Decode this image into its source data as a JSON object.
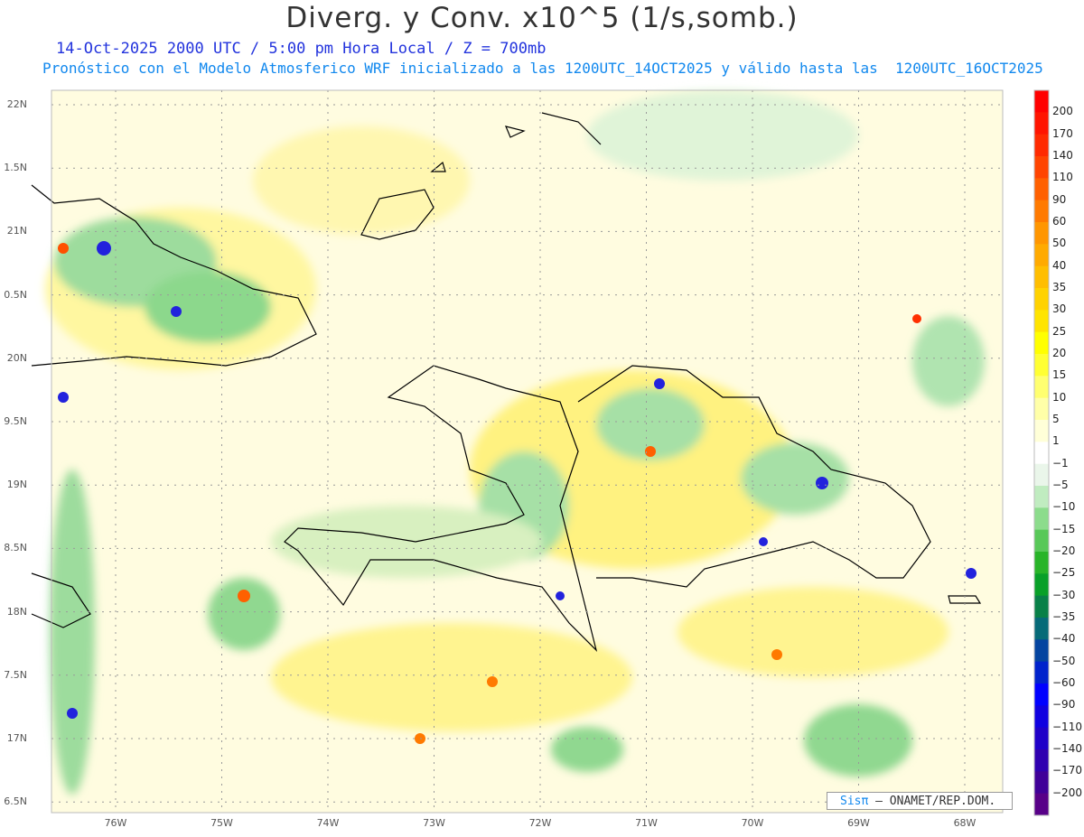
{
  "title": "Diverg. y Conv. x10^5 (1/s,somb.)",
  "subtitle1": "14-Oct-2025  2000 UTC / 5:00 pm Hora Local / Z = 700mb",
  "subtitle2": "Pronóstico con el Modelo Atmosferico WRF inicializado a las 1200UTC_14OCT2025 y válido hasta las  1200UTC_16OCT2025",
  "lat_labels": [
    "22N",
    "1.5N",
    "21N",
    "0.5N",
    "20N",
    "9.5N",
    "19N",
    "8.5N",
    "18N",
    "7.5N",
    "17N",
    "6.5N"
  ],
  "lon_labels": [
    "76W",
    "75W",
    "74W",
    "73W",
    "72W",
    "71W",
    "70W",
    "69W",
    "68W"
  ],
  "colorbar": {
    "labels": [
      "200",
      "170",
      "140",
      "110",
      "90",
      "60",
      "50",
      "40",
      "35",
      "30",
      "25",
      "20",
      "15",
      "10",
      "5",
      "1",
      "−1",
      "−5",
      "−10",
      "−15",
      "−20",
      "−25",
      "−30",
      "−35",
      "−40",
      "−50",
      "−60",
      "−90",
      "−110",
      "−140",
      "−170",
      "−200"
    ],
    "colors": [
      "#ff0000",
      "#ff1400",
      "#ff2a00",
      "#ff4400",
      "#ff6000",
      "#ff7a00",
      "#ff9600",
      "#ffaa00",
      "#ffbe00",
      "#ffd200",
      "#ffe400",
      "#ffff00",
      "#ffff33",
      "#ffff70",
      "#ffffa8",
      "#ffffd8",
      "#ffffff",
      "#eaf6ea",
      "#c0ecc0",
      "#8cdc8c",
      "#58c858",
      "#28b428",
      "#08a028",
      "#088048",
      "#066a78",
      "#0444a0",
      "#0022cc",
      "#0000ff",
      "#1000e0",
      "#2000c8",
      "#3000b0",
      "#400098",
      "#580088"
    ]
  },
  "credit": {
    "brand": "Sisπ",
    "text": " – ONAMET/REP.DOM."
  }
}
